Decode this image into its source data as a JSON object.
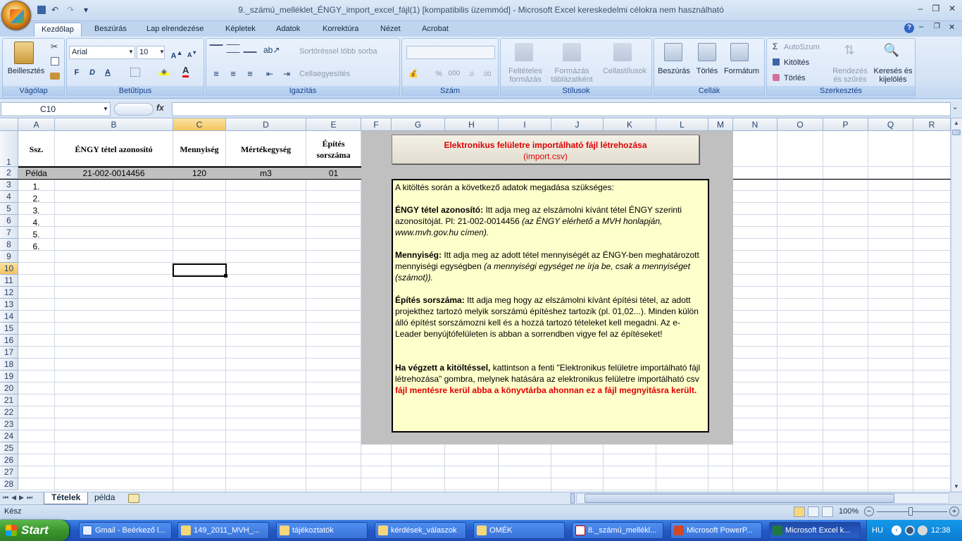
{
  "window": {
    "title": "9._számú_melléklet_ÉNGY_import_excel_fájl(1)  [kompatibilis üzemmód] - Microsoft Excel kereskedelmi célokra nem használható",
    "minimize": "–",
    "restore": "❐",
    "close": "✕",
    "qat_dropdown": "▾"
  },
  "ribbon_tabs": [
    "Kezdőlap",
    "Beszúrás",
    "Lap elrendezése",
    "Képletek",
    "Adatok",
    "Korrektúra",
    "Nézet",
    "Acrobat"
  ],
  "ribbon": {
    "clipboard": {
      "label": "Vágólap",
      "paste": "Beillesztés"
    },
    "font": {
      "label": "Betűtípus",
      "name": "Arial",
      "size": "10",
      "bold": "F",
      "italic": "D",
      "underline": "A"
    },
    "alignment": {
      "label": "Igazítás",
      "wrap": "Sortöréssel több sorba",
      "merge": "Cellaegyesítés"
    },
    "number": {
      "label": "Szám",
      "percent": "%",
      "thousands": "000"
    },
    "styles": {
      "label": "Stílusok",
      "conditional": "Feltételes formázás",
      "table": "Formázás táblázatként",
      "cellstyles": "Cellastílusok"
    },
    "cells": {
      "label": "Cellák",
      "insert": "Beszúrás",
      "delete": "Törlés",
      "format": "Formátum"
    },
    "editing": {
      "label": "Szerkesztés",
      "autosum": "AutoSzum",
      "fill": "Kitöltés",
      "clear": "Törlés",
      "sort": "Rendezés és szűrés",
      "find": "Keresés és kijelölés"
    }
  },
  "formula_bar": {
    "name_box": "C10",
    "fx": "fx",
    "value": ""
  },
  "columns": [
    "A",
    "B",
    "C",
    "D",
    "E",
    "F",
    "G",
    "H",
    "I",
    "J",
    "K",
    "L",
    "M",
    "N",
    "O",
    "P",
    "Q",
    "R"
  ],
  "selected_column": "C",
  "selected_row": "10",
  "rows": [
    "1",
    "2",
    "3",
    "4",
    "5",
    "6",
    "7",
    "8",
    "9",
    "10",
    "11",
    "12",
    "13",
    "14",
    "15",
    "16",
    "17",
    "18",
    "19",
    "20",
    "21",
    "22",
    "23",
    "24",
    "25",
    "26",
    "27",
    "28"
  ],
  "table": {
    "headers": {
      "ssz": "Ssz.",
      "id": "ÉNGY tétel azonosító",
      "qty": "Mennyiség",
      "unit": "Mértékegység",
      "build_1": "Építés",
      "build_2": "sorszáma"
    },
    "example": {
      "ssz": "Példa",
      "id": "21-002-0014456",
      "qty": "120",
      "unit": "m3",
      "build": "01"
    },
    "numbers": [
      "1.",
      "2.",
      "3.",
      "4.",
      "5.",
      "6."
    ]
  },
  "import_button": {
    "title": "Elektronikus felületre importálható fájl létrehozása",
    "subtitle": "(import.csv)"
  },
  "info": {
    "intro": "A kitöltés során a következő adatok megadása szükséges:",
    "p1_bold": "ÉNGY tétel azonosító:",
    "p1_text": " Itt adja meg az elszámolni kívánt tétel ÉNGY szerinti azonosítóját. Pl: 21-002-0014456 ",
    "p1_italic": "(az ÉNGY elérhető a MVH honlapján, www.mvh.gov.hu címen).",
    "p2_bold": "Mennyiség:",
    "p2_text": " Itt adja meg az adott tétel mennyiségét az ÉNGY-ben meghatározott mennyiségi egységben ",
    "p2_italic": "(a mennyiségi egységet ne írja be, csak a mennyiséget (számot)).",
    "p3_bold": "Építés sorszáma:",
    "p3_text": " Itt adja meg hogy az elszámolni kívánt építési tétel, az adott projekthez tartozó melyik sorszámú építéshez tartozik (pl. 01,02...). Minden külön álló építést sorszámozni kell és a hozzá tartozó tételeket kell megadni. Az e-Leader benyújtófelületen is abban a sorrendben vigye fel az építéseket!",
    "p4_bold": "Ha végzett a kitöltéssel,",
    "p4_text": " kattintson a fenti \"Elektronikus felületre importálható fájl létrehozása\" gombra, melynek hatására az elektronikus felületre importálható csv ",
    "p4_red": "fájl mentésre kerül abba a könyvtárba ahonnan ez a fájl megnyitásra került."
  },
  "sheets": [
    "Tételek",
    "példa"
  ],
  "status": {
    "ready": "Kész",
    "zoom": "100%"
  },
  "taskbar": {
    "start": "Start",
    "items": [
      "Gmail - Beérkező l...",
      "149_2011_MVH_...",
      "tájékoztatók",
      "kérdések_válaszok",
      "OMÉK",
      "8._számú_mellékl...",
      "Microsoft PowerP...",
      "Microsoft Excel k..."
    ],
    "lang": "HU",
    "clock": "12:38"
  }
}
